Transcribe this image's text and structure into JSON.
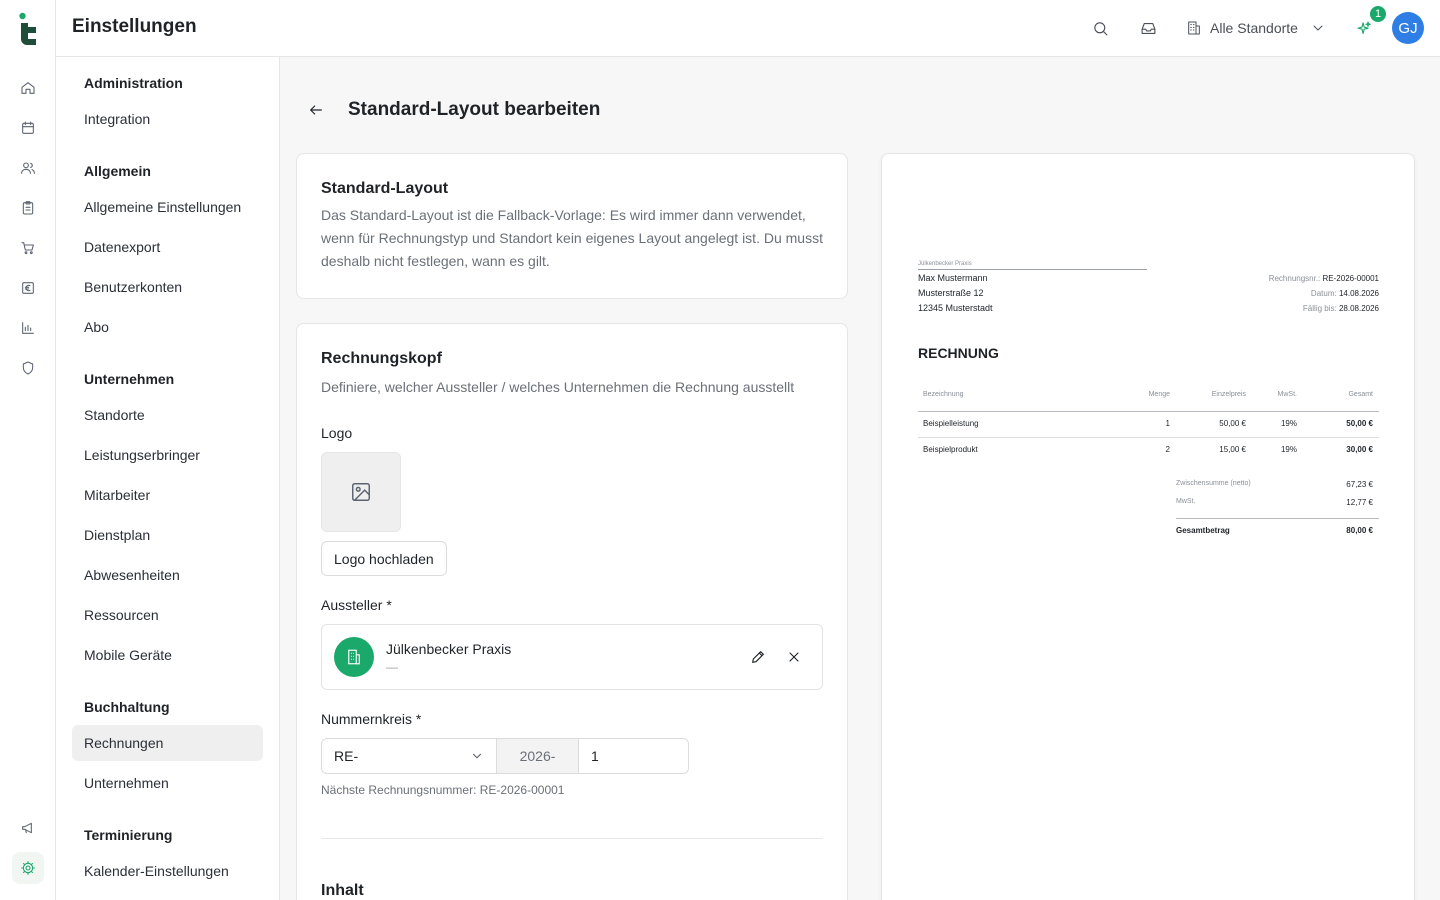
{
  "app": {
    "header_title": "Einstellungen"
  },
  "header": {
    "location_label": "Alle Standorte",
    "notification_count": "1",
    "avatar_initials": "GJ"
  },
  "rail_icons": [
    "home-icon",
    "calendar-icon",
    "users-icon",
    "clipboard-icon",
    "cart-icon",
    "euro-icon",
    "bar-chart-icon",
    "shield-icon",
    "megaphone-icon",
    "gear-icon"
  ],
  "sidebar": {
    "sections": [
      {
        "title": "Administration",
        "items": [
          "Integration"
        ]
      },
      {
        "title": "Allgemein",
        "items": [
          "Allgemeine Einstellungen",
          "Datenexport",
          "Benutzerkonten",
          "Abo"
        ]
      },
      {
        "title": "Unternehmen",
        "items": [
          "Standorte",
          "Leistungserbringer",
          "Mitarbeiter",
          "Dienstplan",
          "Abwesenheiten",
          "Ressourcen",
          "Mobile Geräte"
        ]
      },
      {
        "title": "Buchhaltung",
        "items": [
          "Rechnungen",
          "Unternehmen"
        ]
      },
      {
        "title": "Terminierung",
        "items": [
          "Kalender-Einstellungen"
        ]
      }
    ],
    "active_item": "Rechnungen"
  },
  "page": {
    "title": "Standard-Layout bearbeiten",
    "intro_card": {
      "title": "Standard-Layout",
      "description": "Das Standard-Layout ist die Fallback-Vorlage: Es wird immer dann verwendet, wenn für Rechnungstyp und Standort kein eigenes Layout angelegt ist. Du musst deshalb nicht festlegen, wann es gilt."
    },
    "header_card": {
      "title": "Rechnungskopf",
      "description": "Definiere, welcher Aussteller / welches Unternehmen die Rechnung ausstellt",
      "logo_label": "Logo",
      "upload_button": "Logo hochladen",
      "issuer_label": "Aussteller *",
      "issuer_name": "Jülkenbecker Praxis",
      "issuer_sub": "—",
      "number_label": "Nummernkreis *",
      "prefix_value": "RE-",
      "year_value": "2026-",
      "start_number": "1",
      "next_number_hint": "Nächste Rechnungsnummer: RE-2026-00001",
      "content_title": "Inhalt"
    }
  },
  "preview": {
    "sender_line": "Jülkenbecker Praxis",
    "recipient": [
      "Max Mustermann",
      "Musterstraße 12",
      "12345 Musterstadt"
    ],
    "meta": [
      {
        "label": "Rechnungsnr.:",
        "value": "RE-2026-00001"
      },
      {
        "label": "Datum:",
        "value": "14.08.2026"
      },
      {
        "label": "Fällig bis:",
        "value": "28.08.2026"
      }
    ],
    "heading": "RECHNUNG",
    "columns": [
      "Bezeichnung",
      "Menge",
      "Einzelpreis",
      "MwSt.",
      "Gesamt"
    ],
    "rows": [
      [
        "Beispielleistung",
        "1",
        "50,00 €",
        "19%",
        "50,00 €"
      ],
      [
        "Beispielprodukt",
        "2",
        "15,00 €",
        "19%",
        "30,00 €"
      ]
    ],
    "totals": [
      {
        "label": "Zwischensumme (netto)",
        "value": "67,23 €"
      },
      {
        "label": "MwSt.",
        "value": "12,77 €"
      }
    ],
    "grand_total": {
      "label": "Gesamtbetrag",
      "value": "80,00 €"
    }
  },
  "colors": {
    "accent": "#1aa86b",
    "avatar": "#2f7ee6",
    "active_bg": "#efefef"
  }
}
